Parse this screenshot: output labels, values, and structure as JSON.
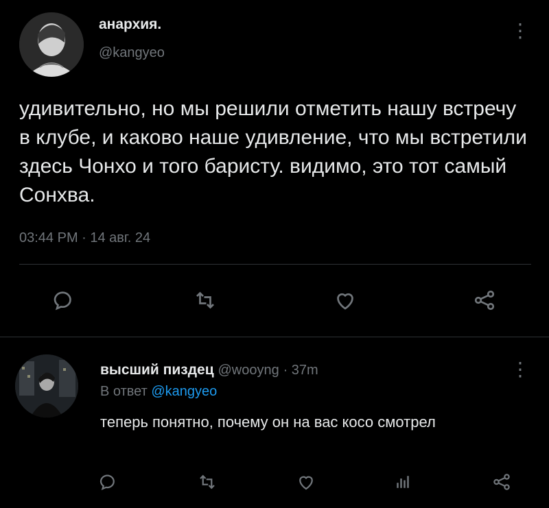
{
  "main_tweet": {
    "author_name": "анархия.",
    "handle": "@kangyeo",
    "text": "удивительно, но мы решили отметить нашу встречу в клубе, и каково наше удивление, что мы встретили здесь Чонхо и того баристу. видимо, это тот самый Сонхва.",
    "timestamp": "03:44 PM · 14 авг. 24",
    "more_glyph": "⋮"
  },
  "reply_tweet": {
    "author_name": "высший пиздец",
    "handle": "@wooyng",
    "time": "· 37m",
    "reply_to_prefix": "В ответ",
    "reply_to_handle": "@kangyeo",
    "text": "теперь понятно, почему он на вас косо смотрел",
    "more_glyph": "⋮"
  },
  "icons": {
    "reply": "reply-icon",
    "retweet": "retweet-icon",
    "like": "heart-icon",
    "share": "share-icon",
    "views": "views-icon"
  },
  "colors": {
    "background": "#000000",
    "text": "#e7e9ea",
    "muted": "#71767b",
    "link": "#1d9bf0",
    "divider": "#2f3336"
  }
}
